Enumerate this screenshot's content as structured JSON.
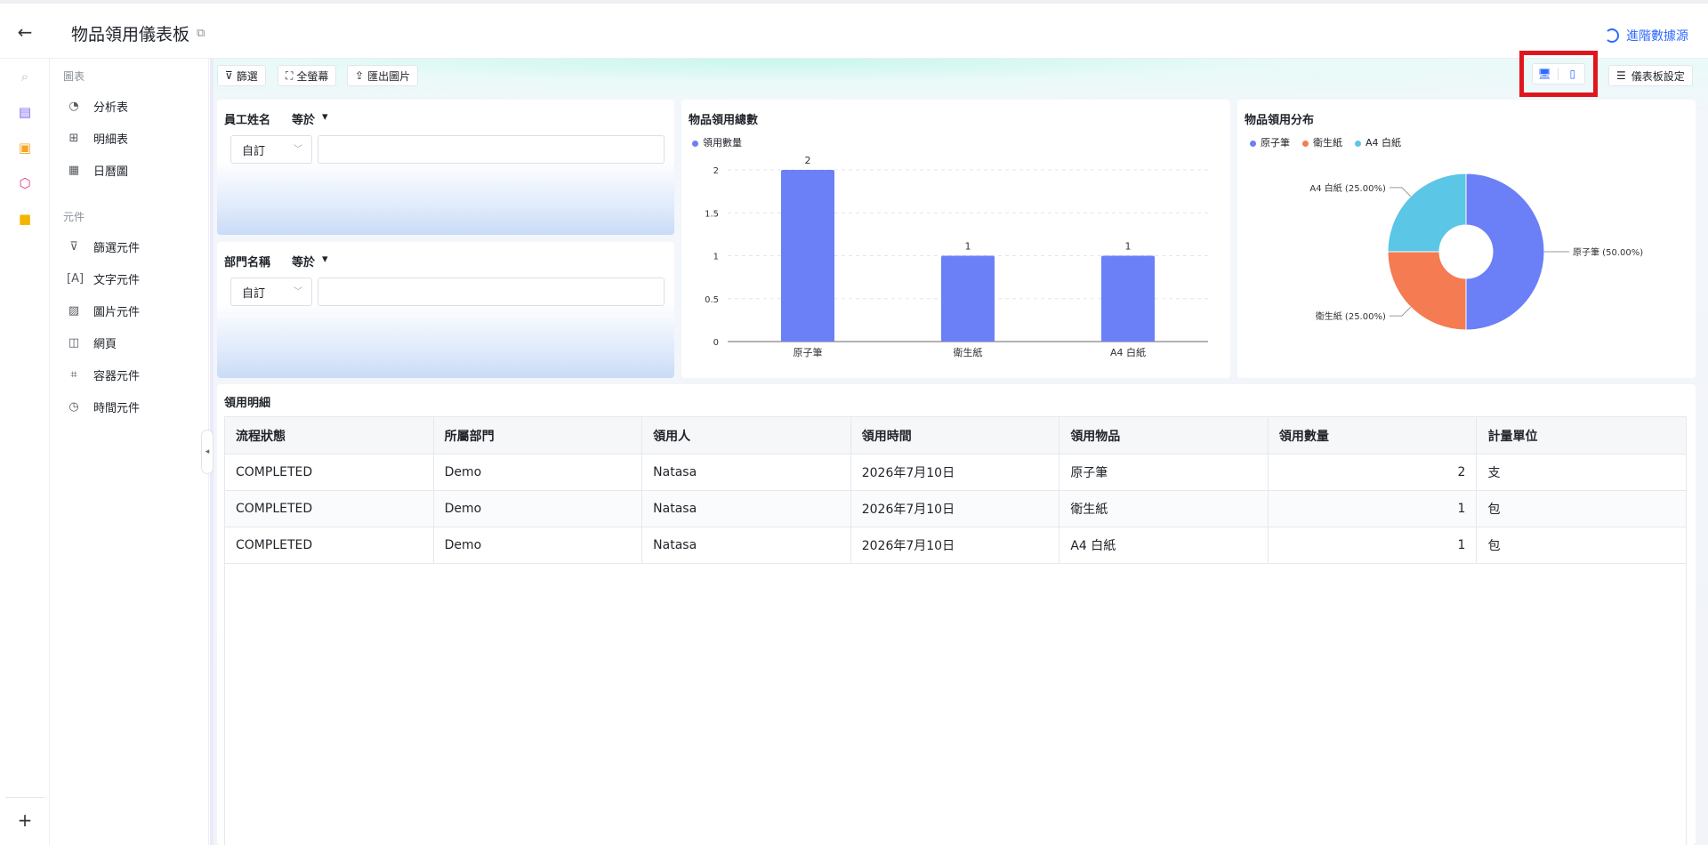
{
  "header": {
    "title": "物品領用儀表板",
    "advanced_link": "進階數據源"
  },
  "side_panel": {
    "charts_section": "圖表",
    "chart_items": [
      "分析表",
      "明細表",
      "日曆圖"
    ],
    "components_section": "元件",
    "component_items": [
      "篩選元件",
      "文字元件",
      "圖片元件",
      "網頁",
      "容器元件",
      "時間元件"
    ]
  },
  "toolbar": {
    "filter_label": "篩選",
    "fullscreen_label": "全螢幕",
    "export_label": "匯出圖片",
    "dashboard_settings_label": "儀表板設定"
  },
  "filters": [
    {
      "label": "員工姓名",
      "operator": "等於",
      "mode": "自訂",
      "value": ""
    },
    {
      "label": "部門名稱",
      "operator": "等於",
      "mode": "自訂",
      "value": ""
    }
  ],
  "colors": {
    "bar": "#6b7ff7",
    "slice_pen": "#6b7ff7",
    "slice_tissue": "#f47b52",
    "slice_a4": "#5bc6e6",
    "accent": "#2f6bff",
    "highlight": "#e0161e"
  },
  "chart_data": [
    {
      "type": "bar",
      "title": "物品領用總數",
      "legend": [
        "領用數量"
      ],
      "categories": [
        "原子筆",
        "衛生紙",
        "A4 白紙"
      ],
      "series": [
        {
          "name": "領用數量",
          "values": [
            2,
            1,
            1
          ]
        }
      ],
      "y_ticks": [
        "0",
        "0.5",
        "1",
        "1.5",
        "2"
      ],
      "data_labels": [
        "2",
        "1",
        "1"
      ],
      "ylim": [
        0,
        2
      ],
      "grid": true
    },
    {
      "type": "pie",
      "title": "物品領用分布",
      "legend": [
        "原子筆",
        "衛生紙",
        "A4 白紙"
      ],
      "slices": [
        {
          "label": "原子筆",
          "value": 50.0,
          "text": "原子筆 (50.00%)"
        },
        {
          "label": "衛生紙",
          "value": 25.0,
          "text": "衛生紙 (25.00%)"
        },
        {
          "label": "A4 白紙",
          "value": 25.0,
          "text": "A4 白紙 (25.00%)"
        }
      ],
      "donut": true
    }
  ],
  "detail": {
    "title": "領用明細",
    "columns": [
      "流程狀態",
      "所屬部門",
      "領用人",
      "領用時間",
      "領用物品",
      "領用數量",
      "計量單位"
    ],
    "rows": [
      [
        "COMPLETED",
        "Demo",
        "Natasa",
        "2026年7月10日",
        "原子筆",
        "2",
        "支"
      ],
      [
        "COMPLETED",
        "Demo",
        "Natasa",
        "2026年7月10日",
        "衛生紙",
        "1",
        "包"
      ],
      [
        "COMPLETED",
        "Demo",
        "Natasa",
        "2026年7月10日",
        "A4 白紙",
        "1",
        "包"
      ]
    ]
  }
}
